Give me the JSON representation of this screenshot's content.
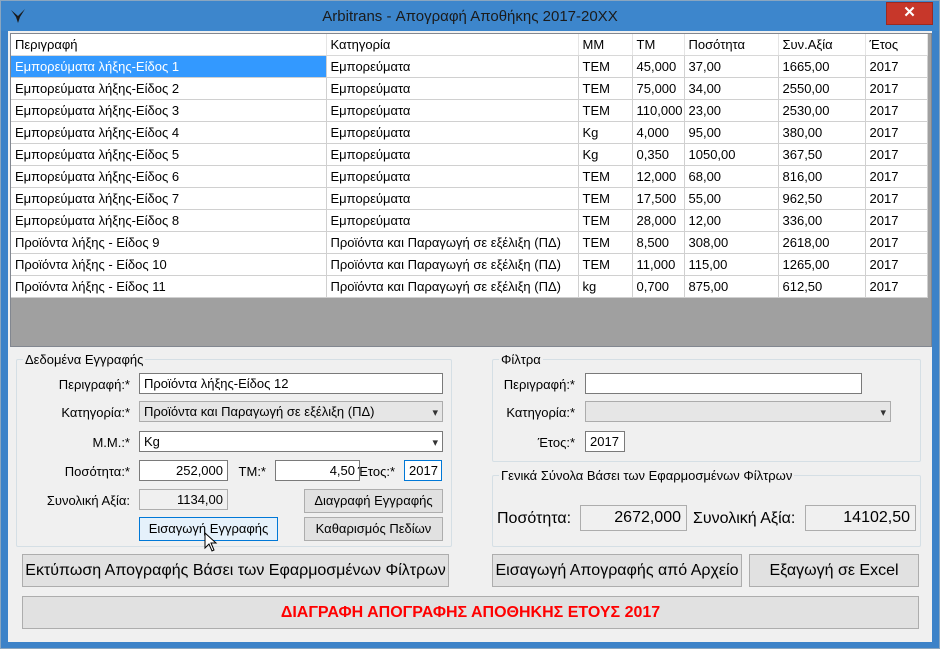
{
  "window": {
    "title": "Arbitrans - Απογραφή Αποθήκης 2017-20XX",
    "close_glyph": "✕"
  },
  "grid": {
    "columns": [
      "Περιγραφή",
      "Κατηγορία",
      "ΜΜ",
      "ΤΜ",
      "Ποσότητα",
      "Συν.Αξία",
      "Έτος"
    ],
    "rows": [
      [
        "Εμπορεύματα λήξης-Είδος 1",
        "Εμπορεύματα",
        "ΤΕΜ",
        "45,000",
        "37,00",
        "1665,00",
        "2017"
      ],
      [
        "Εμπορεύματα λήξης-Είδος 2",
        "Εμπορεύματα",
        "ΤΕΜ",
        "75,000",
        "34,00",
        "2550,00",
        "2017"
      ],
      [
        "Εμπορεύματα λήξης-Είδος 3",
        "Εμπορεύματα",
        "ΤΕΜ",
        "110,000",
        "23,00",
        "2530,00",
        "2017"
      ],
      [
        "Εμπορεύματα λήξης-Είδος 4",
        "Εμπορεύματα",
        "Kg",
        "4,000",
        "95,00",
        "380,00",
        "2017"
      ],
      [
        "Εμπορεύματα λήξης-Είδος 5",
        "Εμπορεύματα",
        "Kg",
        "0,350",
        "1050,00",
        "367,50",
        "2017"
      ],
      [
        "Εμπορεύματα λήξης-Είδος 6",
        "Εμπορεύματα",
        "ΤΕΜ",
        "12,000",
        "68,00",
        "816,00",
        "2017"
      ],
      [
        "Εμπορεύματα λήξης-Είδος 7",
        "Εμπορεύματα",
        "ΤΕΜ",
        "17,500",
        "55,00",
        "962,50",
        "2017"
      ],
      [
        "Εμπορεύματα λήξης-Είδος 8",
        "Εμπορεύματα",
        "ΤΕΜ",
        "28,000",
        "12,00",
        "336,00",
        "2017"
      ],
      [
        "Προϊόντα λήξης - Είδος 9",
        "Προϊόντα και Παραγωγή σε εξέλιξη (ΠΔ)",
        "ΤΕΜ",
        "8,500",
        "308,00",
        "2618,00",
        "2017"
      ],
      [
        "Προϊόντα λήξης - Είδος 10",
        "Προϊόντα και Παραγωγή σε εξέλιξη (ΠΔ)",
        "ΤΕΜ",
        "11,000",
        "115,00",
        "1265,00",
        "2017"
      ],
      [
        "Προϊόντα λήξης - Είδος 11",
        "Προϊόντα και Παραγωγή σε εξέλιξη (ΠΔ)",
        "kg",
        "0,700",
        "875,00",
        "612,50",
        "2017"
      ]
    ],
    "selected_row": 0
  },
  "entry": {
    "legend": "Δεδομένα Εγγραφής",
    "description_label": "Περιγραφή:*",
    "description_value": "Προϊόντα λήξης-Είδος 12",
    "category_label": "Κατηγορία:*",
    "category_value": "Προϊόντα και Παραγωγή σε εξέλιξη (ΠΔ)",
    "unit_label": "Μ.Μ.:*",
    "unit_value": "Kg",
    "quantity_label": "Ποσότητα:*",
    "quantity_value": "252,000",
    "price_label": "ΤΜ:*",
    "price_value": "4,50",
    "year_label": "Έτος:*",
    "year_value": "2017",
    "total_label": "Συνολική Αξία:",
    "total_value": "1134,00",
    "delete_record_button": "Διαγραφή Εγγραφής",
    "insert_record_button": "Εισαγωγή Εγγραφής",
    "clear_fields_button": "Καθαρισμός Πεδίων"
  },
  "filters": {
    "legend": "Φίλτρα",
    "description_label": "Περιγραφή:*",
    "description_value": "",
    "category_label": "Κατηγορία:*",
    "category_value": "",
    "year_label": "Έτος:*",
    "year_value": "2017"
  },
  "totals": {
    "legend": "Γενικά Σύνολα Βάσει των Εφαρμοσμένων Φίλτρων",
    "quantity_label": "Ποσότητα:",
    "quantity_value": "2672,000",
    "value_label": "Συνολική Αξία:",
    "value_value": "14102,50"
  },
  "actions": {
    "print_button": "Εκτύπωση Απογραφής Βάσει των Εφαρμοσμένων Φίλτρων",
    "import_button": "Εισαγωγή Απογραφής από Αρχείο",
    "export_button": "Εξαγωγή σε Excel",
    "delete_year_button": "ΔΙΑΓΡΑΦΗ ΑΠΟΓΡΑΦΗΣ ΑΠΟΘΗΚΗΣ ΕΤΟΥΣ 2017"
  },
  "icons": {
    "app": "bird-logo-icon",
    "dropdown": "▾"
  },
  "colors": {
    "titlebar": "#3d86cc",
    "selection": "#3399ff",
    "delete_text": "#ff0000",
    "close_button": "#c7372a"
  }
}
